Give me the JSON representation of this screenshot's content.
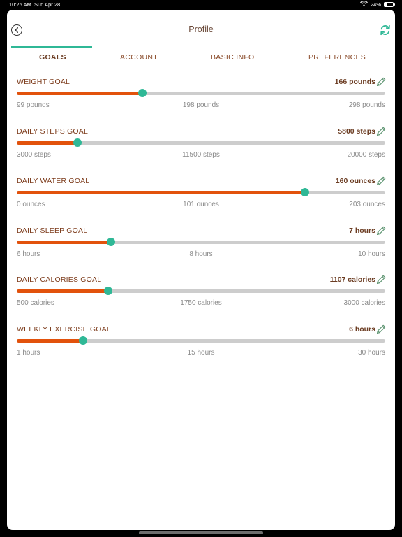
{
  "status_bar": {
    "time": "10:25 AM",
    "date": "Sun Apr 28",
    "battery": "24%",
    "battery_level": 0.24
  },
  "header": {
    "title": "Profile"
  },
  "tabs": [
    {
      "label": "GOALS",
      "active": true
    },
    {
      "label": "ACCOUNT",
      "active": false
    },
    {
      "label": "BASIC INFO",
      "active": false
    },
    {
      "label": "PREFERENCES",
      "active": false
    }
  ],
  "goals": [
    {
      "label": "WEIGHT GOAL",
      "value": "166 pounds",
      "min": "99 pounds",
      "mid": "198 pounds",
      "max": "298 pounds",
      "fraction": 0.34
    },
    {
      "label": "DAILY STEPS GOAL",
      "value": "5800 steps",
      "min": "3000 steps",
      "mid": "11500 steps",
      "max": "20000 steps",
      "fraction": 0.165
    },
    {
      "label": "DAILY WATER GOAL",
      "value": "160 ounces",
      "min": "0 ounces",
      "mid": "101 ounces",
      "max": "203 ounces",
      "fraction": 0.782
    },
    {
      "label": "DAILY SLEEP GOAL",
      "value": "7 hours",
      "min": "6 hours",
      "mid": "8 hours",
      "max": "10 hours",
      "fraction": 0.255
    },
    {
      "label": "DAILY CALORIES GOAL",
      "value": "1107 calories",
      "min": "500 calories",
      "mid": "1750 calories",
      "max": "3000 calories",
      "fraction": 0.248
    },
    {
      "label": "WEEKLY EXERCISE GOAL",
      "value": "6 hours",
      "min": "1 hours",
      "mid": "15 hours",
      "max": "30 hours",
      "fraction": 0.18
    }
  ],
  "colors": {
    "accent": "#2fb896",
    "fill": "#e2520c",
    "track": "#cdcdcd",
    "text": "#7d3c1c"
  },
  "icons": {
    "back": "back-arrow-circle-icon",
    "sync": "sync-icon",
    "edit": "pencil-icon",
    "wifi": "wifi-icon",
    "battery": "battery-icon"
  }
}
